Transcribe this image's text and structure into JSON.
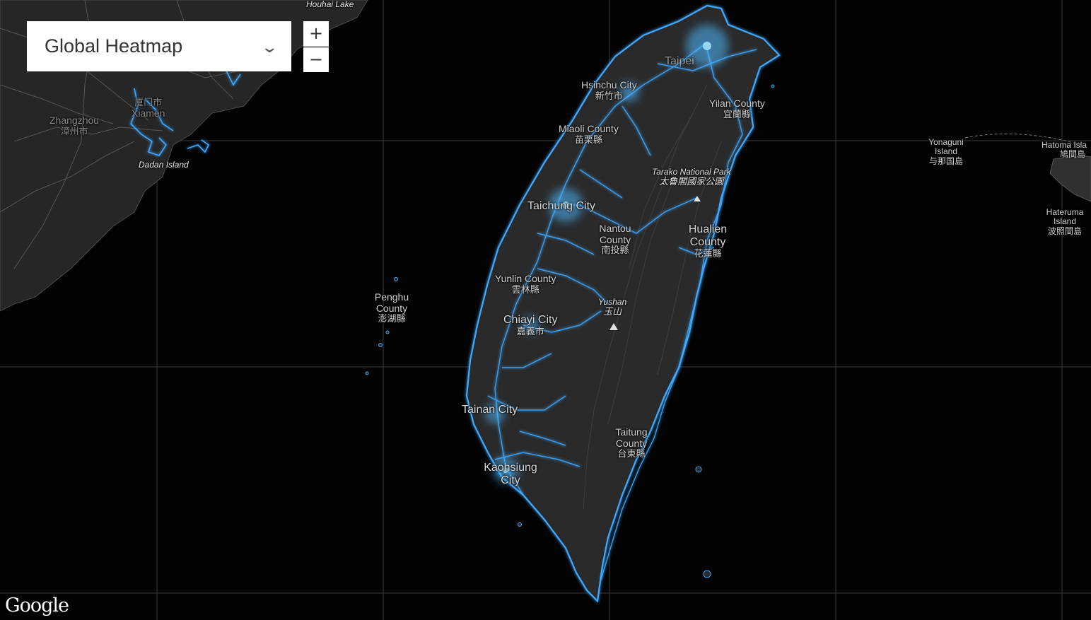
{
  "layer_selector": {
    "value": "Global Heatmap",
    "chevron": "chevron-down-icon"
  },
  "zoom": {
    "in_label": "+",
    "out_label": "−"
  },
  "attribution": "Google",
  "colors": {
    "heat": "#3fa9ff",
    "heat_bright": "#9fe3ff",
    "land": "#2a2a2a",
    "ocean": "#030303"
  },
  "labels": {
    "houhai_lake": "Houhai Lake",
    "zhangzhou": "Zhangzhou",
    "zhangzhou_zh": "漳州市",
    "xiamen": "Xiamen",
    "xiamen_zh": "厦门市",
    "dadan": "Dadan Island",
    "hsinchu": "Hsinchu City",
    "hsinchu_zh": "新竹市",
    "taipei": "Taipei",
    "yilan": "Yilan County",
    "yilan_zh": "宜蘭縣",
    "miaoli": "Miaoli County",
    "miaoli_zh": "苗栗縣",
    "taroko": "Tarako National Park",
    "taroko_zh": "太魯閣國家公園",
    "taichung": "Taichung City",
    "nantou": "Nantou County",
    "nantou_zh": "南投縣",
    "hualien": "Hualien County",
    "hualien_zh": "花蓮縣",
    "yunlin": "Yunlin County",
    "yunlin_zh": "雲林縣",
    "penghu": "Penghu County",
    "penghu_zh": "澎湖縣",
    "yushan": "Yushan",
    "yushan_zh": "玉山",
    "chiayi": "Chiayi City",
    "chiayi_zh": "嘉義市",
    "tainan": "Tainan City",
    "taitung": "Taitung County",
    "taitung_zh": "台東縣",
    "kaohsiung": "Kaohsiung City",
    "yonaguni": "Yonaguni Island",
    "yonaguni_zh": "与那国島",
    "hatoma": "Hatoma Isla",
    "hatoma_zh": "鳩間島",
    "hateruma": "Hateruma Island",
    "hateruma_zh": "波照間島"
  }
}
